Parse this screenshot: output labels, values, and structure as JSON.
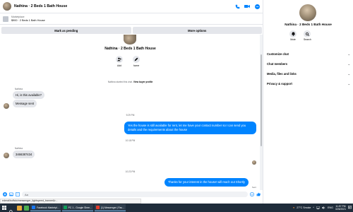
{
  "header": {
    "title": "Nathina · 2 Beds 1 Bath House"
  },
  "listing": {
    "label": "Marketplace",
    "summary": "$900 · 2 Beds 1 Bath House"
  },
  "actions": {
    "mark_pending": "Mark as pending",
    "more_options": "More options"
  },
  "conversation": {
    "name": "Nathina · 2 Beds 1 Bath House",
    "add_label": "Add",
    "home_label": "home",
    "system_text": "Nathina started this chat.",
    "system_link": "View buyer profile",
    "sender_1": "Nathina",
    "msg_in_1": "Hi, is this available?",
    "msg_in_2": "Message sent",
    "time_1": "9:29 PM",
    "msg_out_1": "Yes the house is still available for rent, let me have your contact number so I can send you details and the requirements about the house",
    "time_2": "10:18 PM",
    "sender_2": "Nathina",
    "msg_in_3": "3466387434",
    "time_3": "10:23 PM",
    "msg_out_2": "Thanks for your interest in the house! will reach out Shortly",
    "sent_label": "Sent"
  },
  "composer": {
    "placeholder": "Aa"
  },
  "status_url": "ederal/buffalo/messenger_lightspeed_banner&r...",
  "sidepanel": {
    "title": "Nathina · 2 Beds 1 Bath House",
    "mute": "Mute",
    "search": "Search",
    "sections": [
      "Customize chat",
      "Chat members",
      "Media, files and links",
      "Privacy & support"
    ]
  },
  "taskbar": {
    "tasks": [
      "Facebook Marketpl...",
      "PC 1 - Google Shee...",
      "(1) Messenger | Fac..."
    ],
    "weather": "27°C  Smoke",
    "lang": "ENG",
    "time": "11:57 PM",
    "date": "3/26/2021"
  },
  "colors": {
    "accent": "#0084ff",
    "bubble_in": "#e4e6eb",
    "taskbar": "#1f2c3a"
  }
}
